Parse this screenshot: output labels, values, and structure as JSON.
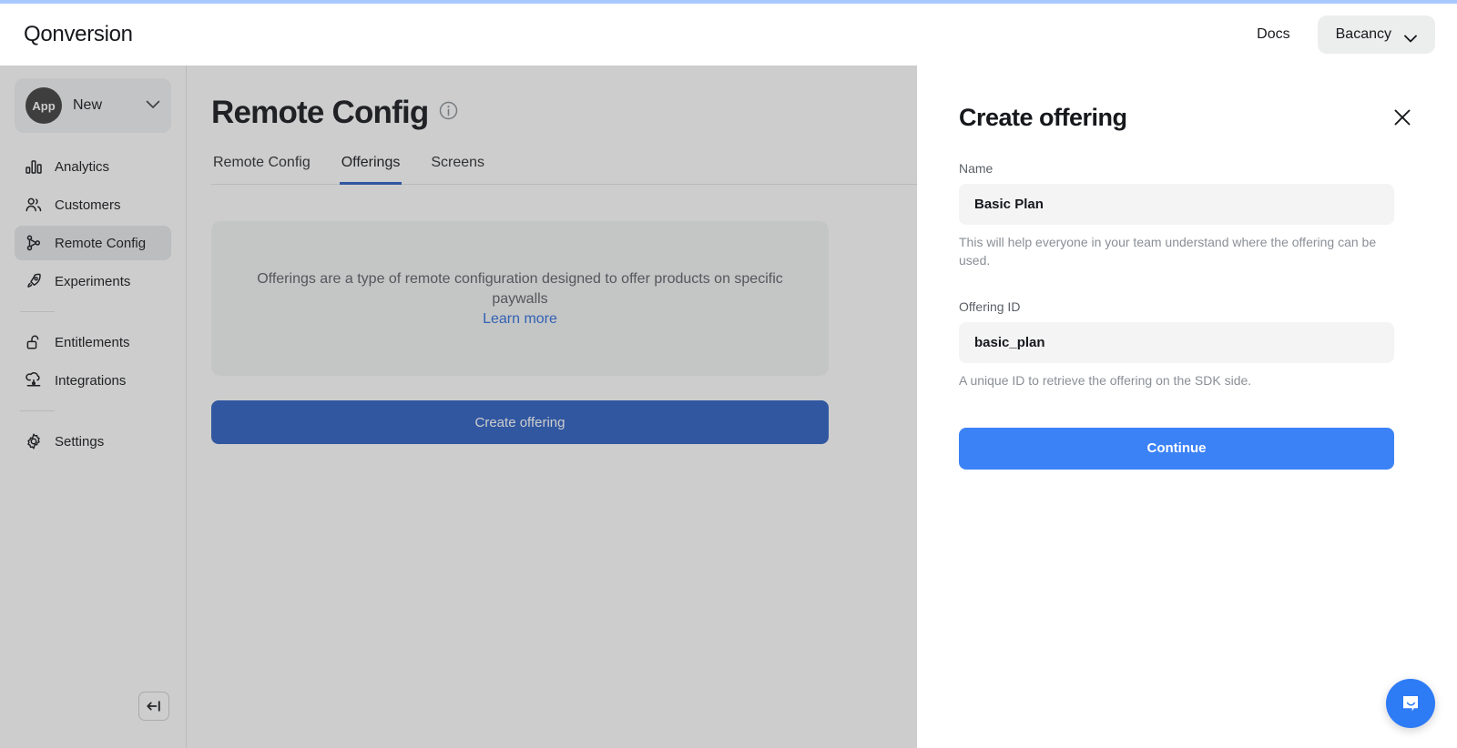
{
  "topnav": {
    "brand": "Qonversion",
    "docs_label": "Docs",
    "account_label": "Bacancy"
  },
  "sidebar": {
    "app_switcher": {
      "avatar_label": "App",
      "name": "New"
    },
    "items": [
      {
        "label": "Analytics",
        "icon": "bar-chart-icon",
        "active": false
      },
      {
        "label": "Customers",
        "icon": "users-icon",
        "active": false
      },
      {
        "label": "Remote Config",
        "icon": "branch-icon",
        "active": true
      },
      {
        "label": "Experiments",
        "icon": "rocket-icon",
        "active": false
      },
      {
        "label": "Entitlements",
        "icon": "unlock-icon",
        "active": false
      },
      {
        "label": "Integrations",
        "icon": "integration-icon",
        "active": false
      },
      {
        "label": "Settings",
        "icon": "gear-icon",
        "active": false
      }
    ]
  },
  "main": {
    "page_title": "Remote Config",
    "tabs": [
      {
        "label": "Remote Config",
        "active": false
      },
      {
        "label": "Offerings",
        "active": true
      },
      {
        "label": "Screens",
        "active": false
      }
    ],
    "empty_state": {
      "description": "Offerings are a type of remote configuration designed to offer products on specific paywalls",
      "link_label": "Learn more"
    },
    "create_offering_label": "Create offering"
  },
  "drawer": {
    "title": "Create offering",
    "name_label": "Name",
    "name_value": "Basic Plan",
    "name_placeholder": "Name",
    "name_help": "This will help everyone in your team understand where the offering can be used.",
    "offering_id_label": "Offering ID",
    "offering_id_value": "basic_plan",
    "offering_id_placeholder": "Offering ID",
    "offering_id_help": "A unique ID to retrieve the offering on the SDK side.",
    "continue_label": "Continue"
  },
  "colors": {
    "accent_blue": "#3b82f6",
    "button_blue": "#2d61c4",
    "link_blue": "#2f6fdd",
    "progress_blue": "#a9c8ff",
    "chat_blue": "#2e7bf6"
  }
}
